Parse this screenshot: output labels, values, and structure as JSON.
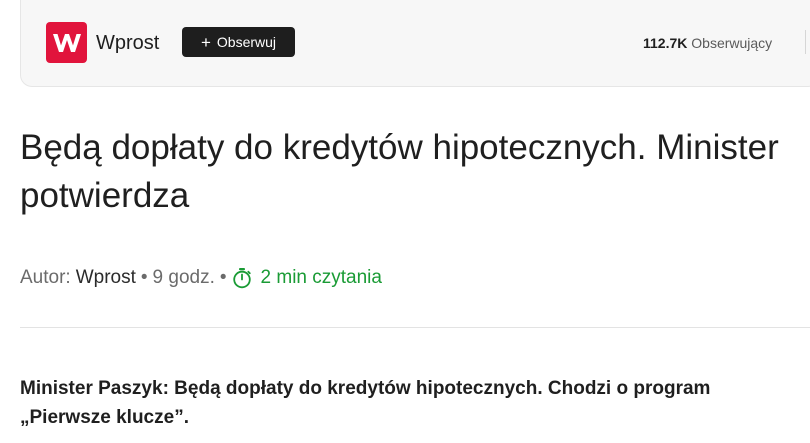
{
  "publisher": {
    "logo_letter": "W",
    "name": "Wprost",
    "follow_label": "Obserwuj",
    "followers_count": "112.7K",
    "followers_label": "Obserwujący",
    "brand_color": "#e1143c"
  },
  "article": {
    "title": "Będą dopłaty do kredytów hipotecznych. Minister potwierdza",
    "author_prefix": "Autor:",
    "author": "Wprost",
    "separator": "•",
    "published": "9 godz.",
    "reading_time": "2 min czytania",
    "reading_icon": "stopwatch-icon",
    "reading_color": "#1a9b35",
    "lead": "Minister Paszyk: Będą dopłaty do kredytów hipotecznych. Chodzi o program „Pierwsze klucze”."
  }
}
